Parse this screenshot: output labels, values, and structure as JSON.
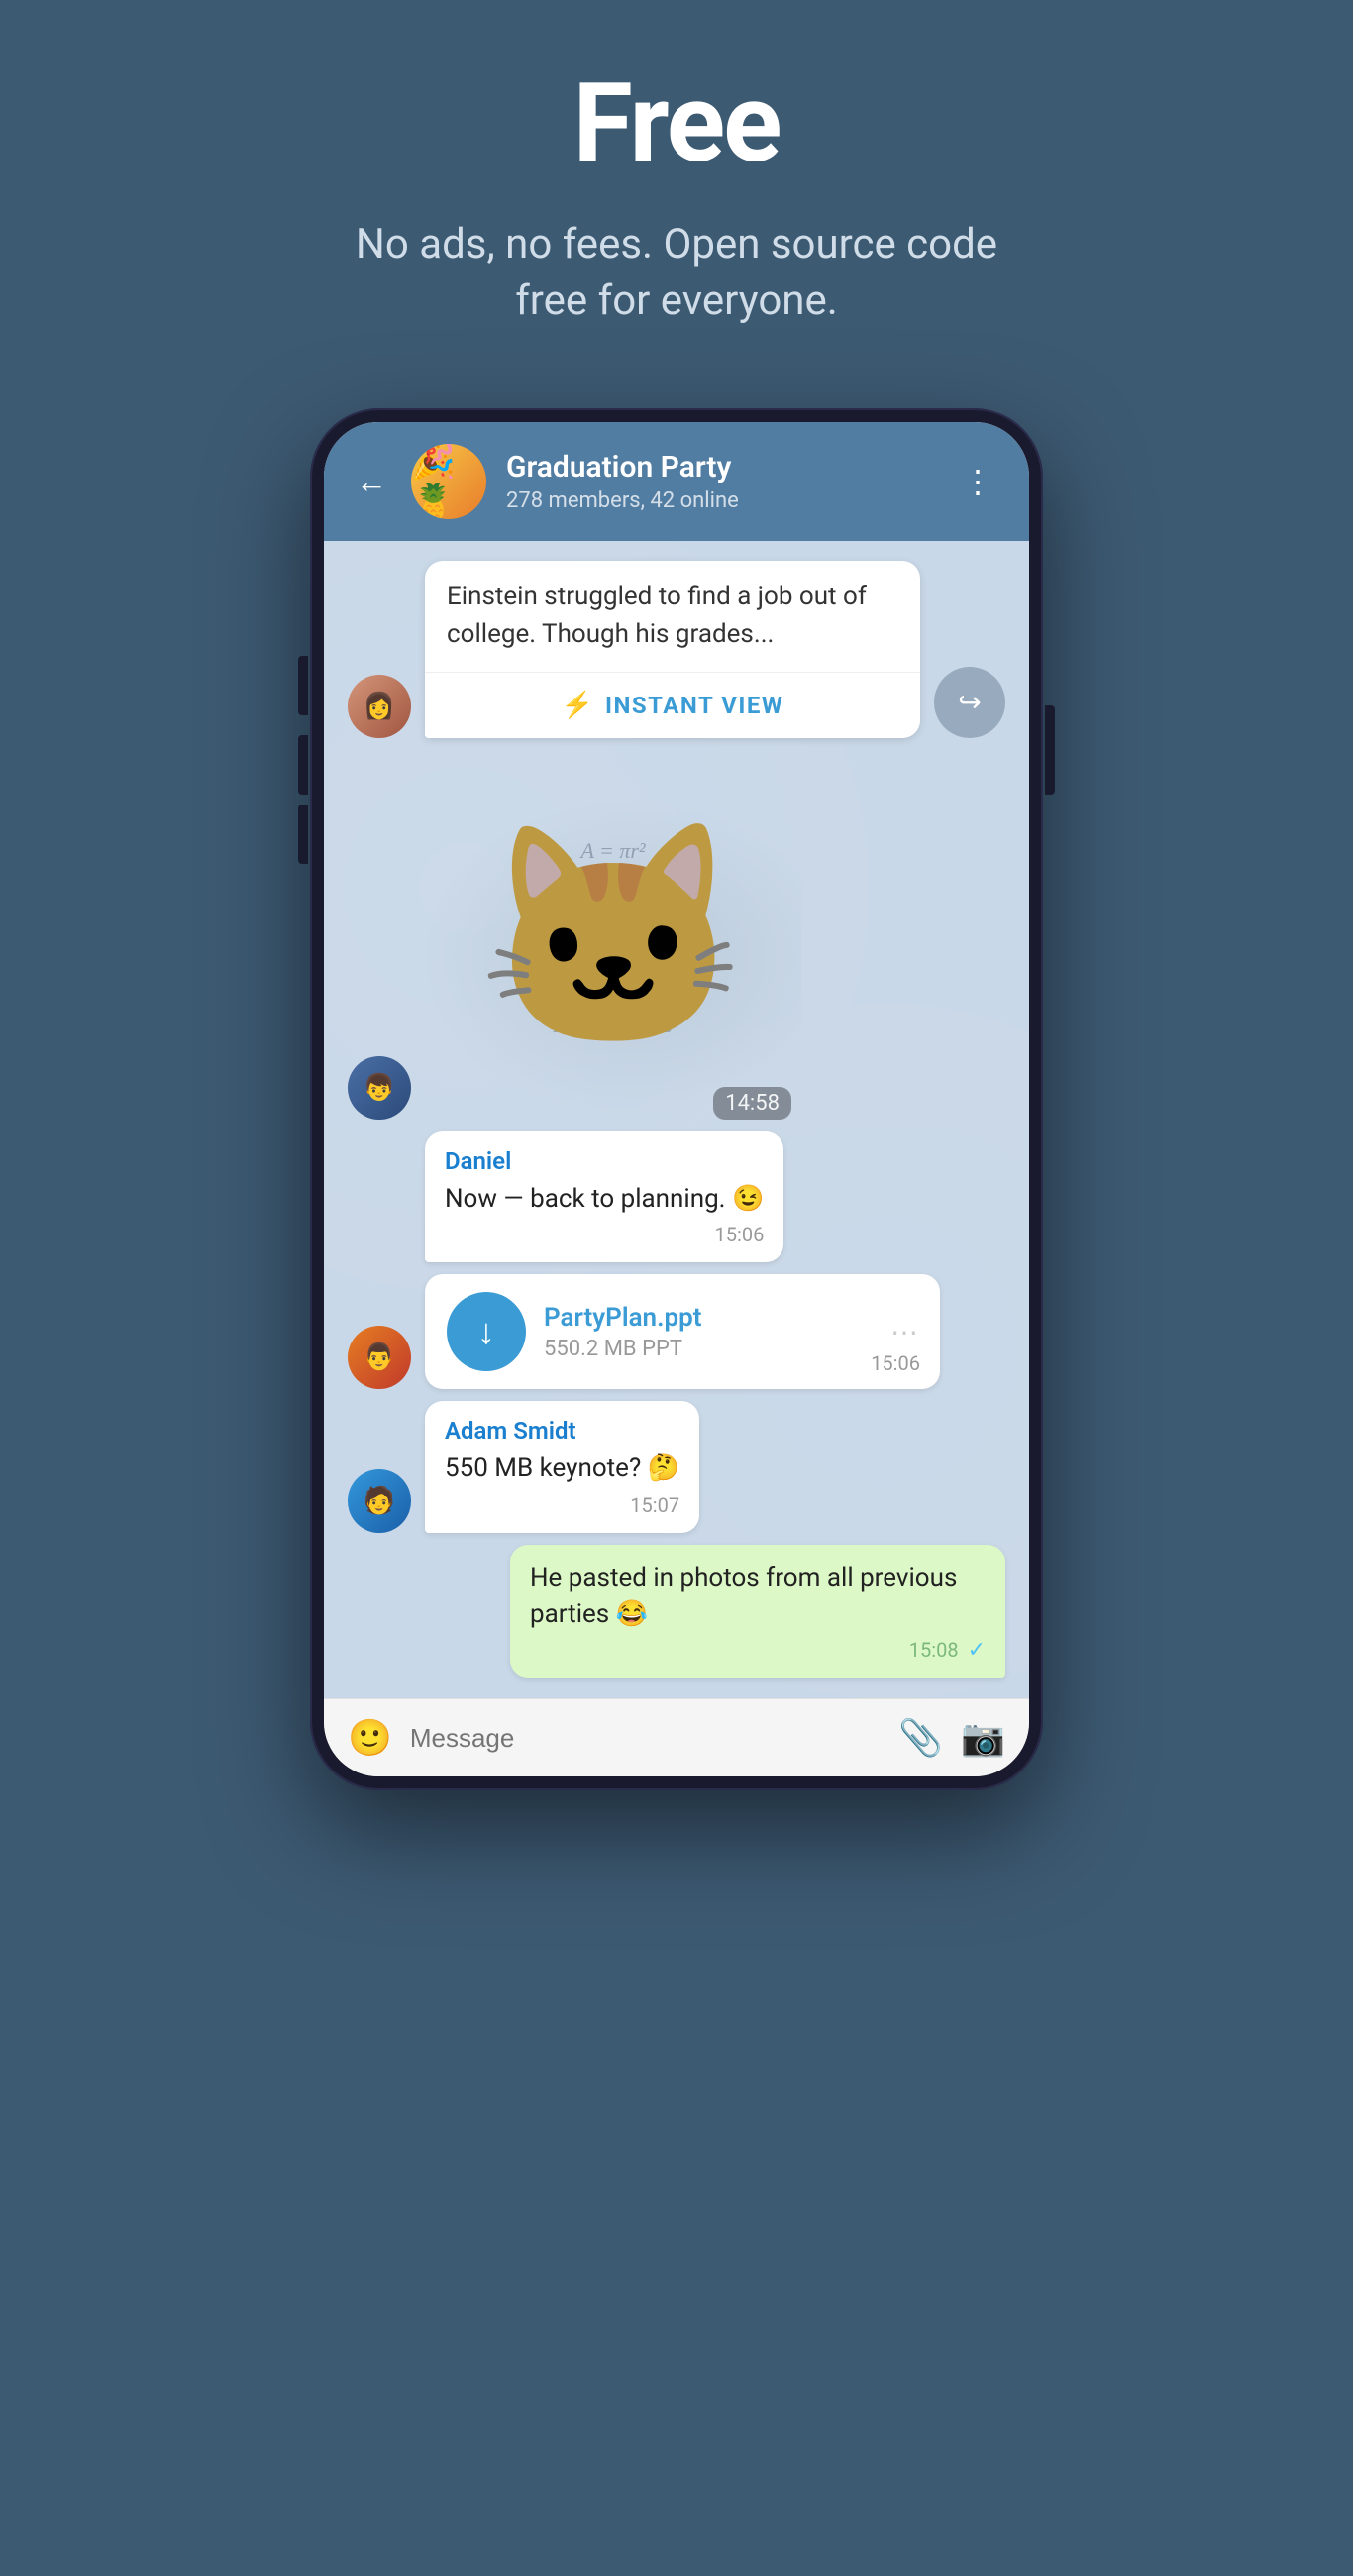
{
  "hero": {
    "title": "Free",
    "subtitle": "No ads, no fees. Open source code free for everyone."
  },
  "phone": {
    "header": {
      "group_name": "Graduation Party",
      "group_meta": "278 members, 42 online",
      "back_label": "←",
      "menu_label": "⋮"
    },
    "messages": [
      {
        "id": "msg-article",
        "type": "iv",
        "text": "Einstein struggled to find a job out of college. Though his grades...",
        "iv_button": "INSTANT VIEW",
        "avatar_type": "girl"
      },
      {
        "id": "msg-sticker",
        "type": "sticker",
        "time": "14:58",
        "avatar_type": "hoodie"
      },
      {
        "id": "msg-daniel",
        "type": "text",
        "sender": "Daniel",
        "text": "Now — back to planning. 😉",
        "time": "15:06",
        "avatar_type": "none"
      },
      {
        "id": "msg-file",
        "type": "file",
        "file_name": "PartyPlan.ppt",
        "file_size": "550.2 MB PPT",
        "time": "15:06",
        "avatar_type": "glasses"
      },
      {
        "id": "msg-adam",
        "type": "text",
        "sender": "Adam Smidt",
        "text": "550 MB keynote? 🤔",
        "time": "15:07",
        "avatar_type": "beanie"
      },
      {
        "id": "msg-self",
        "type": "text_green",
        "text": "He pasted in photos from all previous parties 😂",
        "time": "15:08",
        "has_check": true
      }
    ],
    "input": {
      "placeholder": "Message"
    }
  }
}
